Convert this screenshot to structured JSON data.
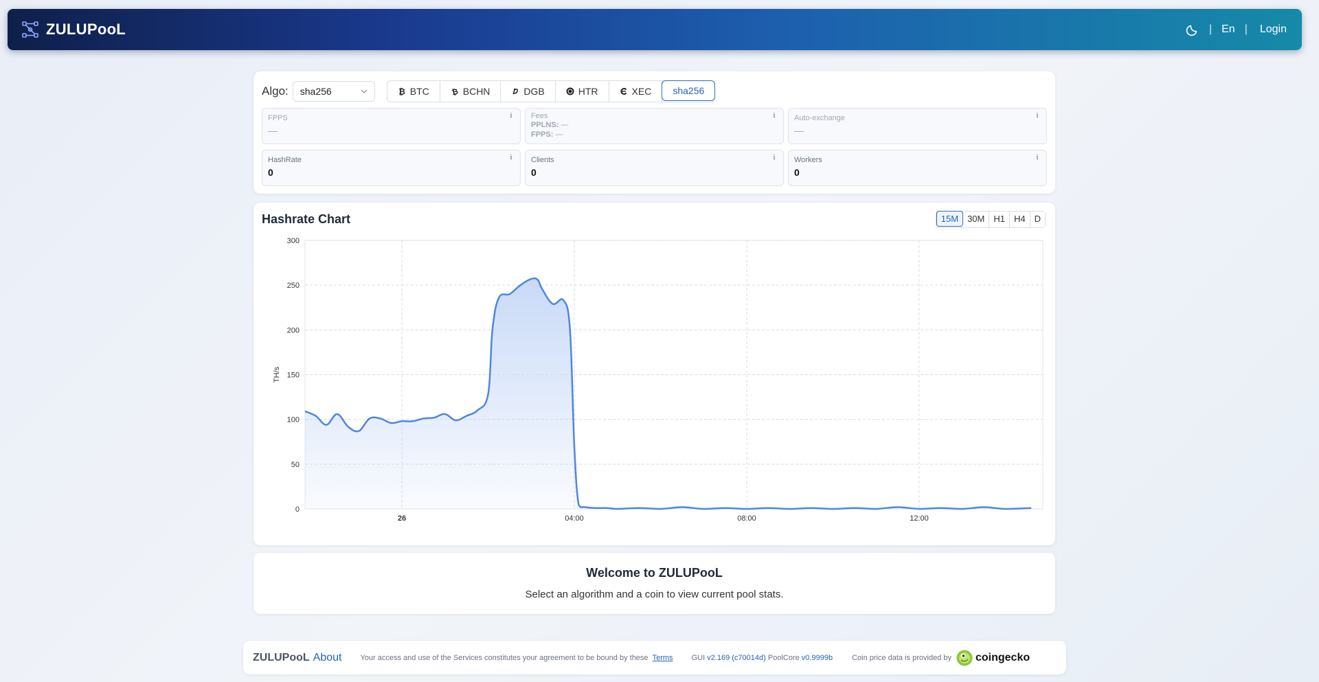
{
  "header": {
    "brand": "ZULUPooL",
    "lang": "En",
    "login": "Login",
    "sep": "|"
  },
  "algo": {
    "label": "Algo:",
    "selected": "sha256"
  },
  "coins": [
    {
      "label": "BTC",
      "icon": "btc-icon"
    },
    {
      "label": "BCHN",
      "icon": "bch-icon"
    },
    {
      "label": "DGB",
      "icon": "dgb-icon"
    },
    {
      "label": "HTR",
      "icon": "htr-icon"
    },
    {
      "label": "XEC",
      "icon": "xec-icon"
    },
    {
      "label": "sha256",
      "icon": "",
      "active": true
    }
  ],
  "stats": {
    "fpps": {
      "label": "FPPS",
      "value": "—"
    },
    "fees": {
      "label": "Fees",
      "pplns_label": "PPLNS:",
      "pplns_value": "—",
      "fpps_label": "FPPS:",
      "fpps_value": "—"
    },
    "autoexchange": {
      "label": "Auto-exchange",
      "value": "—"
    },
    "hashrate": {
      "label": "HashRate",
      "value": "0"
    },
    "clients": {
      "label": "Clients",
      "value": "0"
    },
    "workers": {
      "label": "Workers",
      "value": "0"
    },
    "info": "i"
  },
  "chart": {
    "title": "Hashrate Chart",
    "timeframes": [
      "15M",
      "30M",
      "H1",
      "H4",
      "D"
    ],
    "active_timeframe": "15M"
  },
  "chart_data": {
    "type": "area",
    "ylabel": "TH/s",
    "ylim": [
      0,
      300
    ],
    "yticks": [
      0,
      50,
      100,
      150,
      200,
      250,
      300
    ],
    "xticks": [
      {
        "label": "26",
        "hour": 0,
        "bold": true
      },
      {
        "label": "04:00",
        "hour": 4
      },
      {
        "label": "08:00",
        "hour": 8
      },
      {
        "label": "12:00",
        "hour": 12
      }
    ],
    "x_hours": [
      -2.25,
      -2.0,
      -1.75,
      -1.5,
      -1.25,
      -1.0,
      -0.75,
      -0.5,
      -0.25,
      0.0,
      0.25,
      0.5,
      0.75,
      1.0,
      1.25,
      1.5,
      1.75,
      2.0,
      2.1,
      2.25,
      2.5,
      2.75,
      3.0,
      3.15,
      3.25,
      3.5,
      3.75,
      3.9,
      4.0,
      4.1,
      4.25,
      4.5,
      4.75,
      5.0,
      5.5,
      6.0,
      6.5,
      7.0,
      7.5,
      8.0,
      8.5,
      9.0,
      9.5,
      10.0,
      10.5,
      11.0,
      11.5,
      12.0,
      12.5,
      13.0,
      13.5,
      14.0,
      14.6
    ],
    "values": [
      109,
      104,
      94,
      106,
      92,
      87,
      101,
      101,
      96,
      98,
      98,
      101,
      102,
      106,
      99,
      104,
      110,
      128,
      200,
      236,
      240,
      250,
      257,
      256,
      246,
      229,
      233,
      200,
      70,
      5,
      2,
      1,
      1,
      0,
      1,
      0,
      2,
      0,
      1,
      0,
      1,
      0,
      1,
      0,
      1,
      0,
      2,
      0,
      1,
      0,
      2,
      0,
      1
    ]
  },
  "welcome": {
    "title": "Welcome to ZULUPooL",
    "text": "Select an algorithm and a coin to view current pool stats."
  },
  "footer": {
    "brand": "ZULUPooL",
    "about": "About",
    "terms_text": "Your access and use of the Services constitutes your agreement to be bound by these",
    "terms_link": "Terms",
    "gui_label": "GUI",
    "gui_version": "v2.169 (c70014d)",
    "core_label": "PoolCore",
    "core_version": "v0.9999b",
    "price_text": "Coin price data is provided by",
    "coingecko": "coingecko"
  },
  "colors": {
    "accent": "#2563b8",
    "line": "#4f86df",
    "fill_top": "#c6d8f7"
  }
}
